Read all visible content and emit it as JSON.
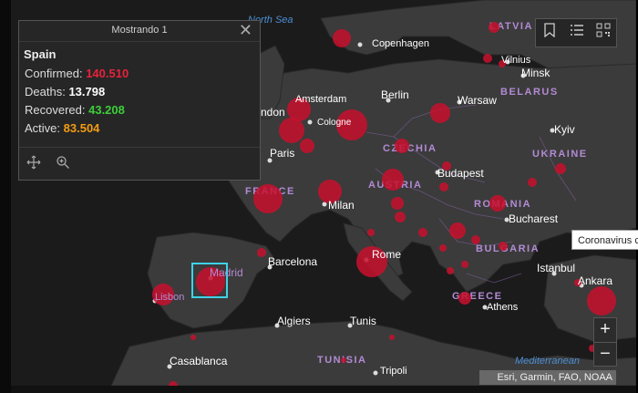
{
  "popup": {
    "title": "Mostrando 1",
    "country": "Spain",
    "rows": [
      {
        "label": "Confirmed:",
        "value": "140.510",
        "color": "#e8233a"
      },
      {
        "label": "Deaths:",
        "value": "13.798",
        "color": "#ffffff"
      },
      {
        "label": "Recovered:",
        "value": "43.208",
        "color": "#3bcf38"
      },
      {
        "label": "Active:",
        "value": "83.504",
        "color": "#f39c12"
      }
    ]
  },
  "tooltip": "Coronavirus c",
  "attribution": "Esri, Garmin, FAO, NOAA",
  "seas": [
    "North Sea",
    "Mediterranean"
  ],
  "countries": [
    "LATVIA",
    "BELARUS",
    "CZECHIA",
    "UKRAINE",
    "FRANCE",
    "AUSTRIA",
    "ROMANIA",
    "BULGARIA",
    "GREECE",
    "TUNISIA"
  ],
  "cities": [
    "Copenhagen",
    "Vilnius",
    "Minsk",
    "Amsterdam",
    "Berlin",
    "Warsaw",
    "Cologne",
    "Kyiv",
    "ndon",
    "Paris",
    "Budapest",
    "Milan",
    "Bucharest",
    "Madrid",
    "Barcelona",
    "Rome",
    "Istanbul",
    "Lisbon",
    "Ankara",
    "Algiers",
    "Tunis",
    "Athens",
    "Casablanca",
    "Tripoli"
  ],
  "colors": {
    "bubble": "#c8102e",
    "highlight": "#3fd2e6",
    "map_bg": "#1b1b1b",
    "land": "#3a3a3a",
    "country_label": "#b28bd4"
  },
  "icons": {
    "close": "close-icon",
    "bookmark": "bookmark-icon",
    "list": "list-icon",
    "qr": "qr-icon",
    "move": "move-icon",
    "zoom_to": "zoom-to-icon"
  }
}
